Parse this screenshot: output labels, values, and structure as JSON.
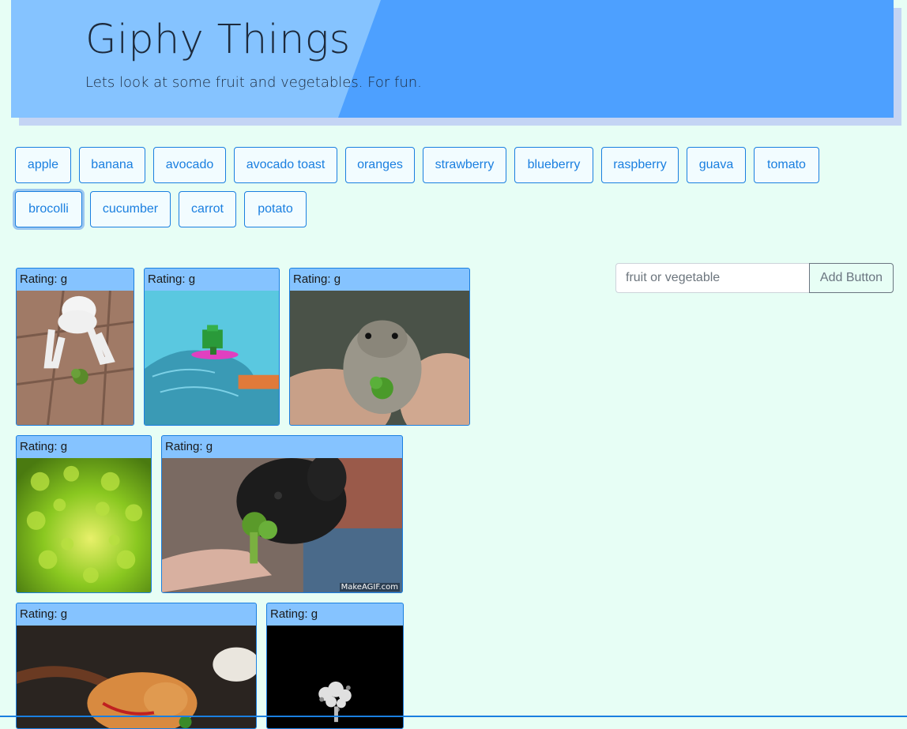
{
  "header": {
    "title": "Giphy Things",
    "subtitle": "Lets look at some fruit and vegetables. For fun."
  },
  "topics": [
    "apple",
    "banana",
    "avocado",
    "avocado toast",
    "oranges",
    "strawberry",
    "blueberry",
    "raspberry",
    "guava",
    "tomato",
    "brocolli",
    "cucumber",
    "carrot",
    "potato"
  ],
  "active_topic": "brocolli",
  "form": {
    "placeholder": "fruit or vegetable",
    "value": "",
    "add_label": "Add Button"
  },
  "gifs": [
    {
      "rating": "Rating: g",
      "subject": "dog-with-broccoli-icon"
    },
    {
      "rating": "Rating: g",
      "subject": "pixel-broccoli-surfing-icon"
    },
    {
      "rating": "Rating: g",
      "subject": "hamster-eating-broccoli-icon"
    },
    {
      "rating": "Rating: g",
      "subject": "romanesco-broccoli-icon"
    },
    {
      "rating": "Rating: g",
      "subject": "puppy-eating-broccoli-icon",
      "watermark": "MakeAGIF.com"
    },
    {
      "rating": "Rating: g",
      "subject": "cat-eating-broccoli-icon"
    },
    {
      "rating": "Rating: g",
      "subject": "glowing-broccoli-dark-icon"
    }
  ],
  "colors": {
    "page_bg": "#e7fef5",
    "header_light": "#85c3ff",
    "header_dark": "#4da0ff",
    "accent": "#1a7fe0"
  }
}
